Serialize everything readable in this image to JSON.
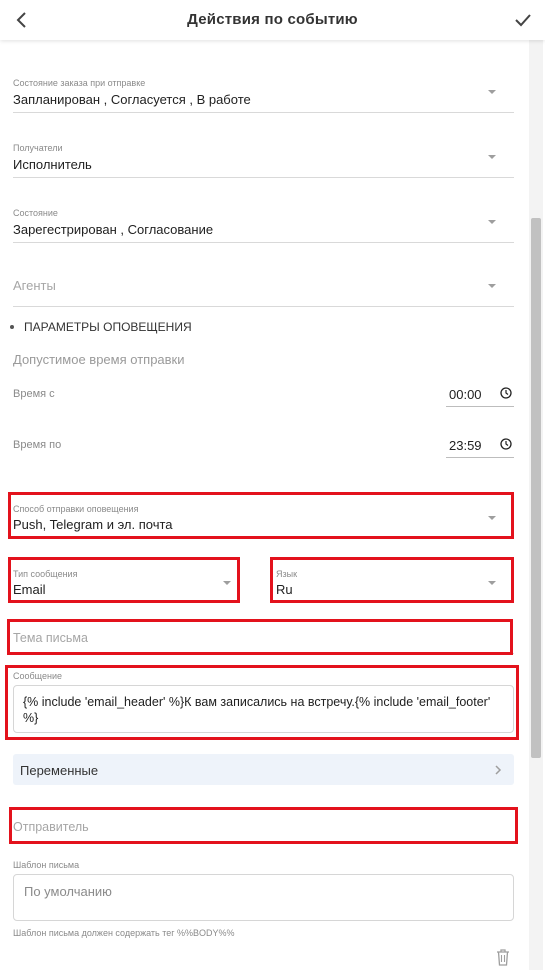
{
  "header": {
    "title": "Действия по событию"
  },
  "fields": {
    "order_state": {
      "label": "Состояние заказа при отправке",
      "value": "Запланирован , Согласуется , В работе"
    },
    "recipients": {
      "label": "Получатели",
      "value": "Исполнитель"
    },
    "state": {
      "label": "Состояние",
      "value": "Зарегестрирован , Согласование"
    },
    "agents": {
      "placeholder": "Агенты"
    }
  },
  "notification": {
    "section_title": "ПАРАМЕТРЫ ОПОВЕЩЕНИЯ",
    "allowed_time_title": "Допустимое время отправки",
    "time_from": {
      "label": "Время с",
      "value": "00:00"
    },
    "time_to": {
      "label": "Время по",
      "value": "23:59"
    },
    "method": {
      "label": "Способ отправки оповещения",
      "value": "Push, Telegram и эл. почта"
    },
    "message_type": {
      "label": "Тип сообщения",
      "value": "Email"
    },
    "language": {
      "label": "Язык",
      "value": "Ru"
    },
    "subject": {
      "placeholder": "Тема письма"
    },
    "message": {
      "label": "Сообщение",
      "value": "{% include 'email_header' %}К вам записались на встречу.{% include 'email_footer' %}"
    },
    "variables_label": "Переменные",
    "sender": {
      "placeholder": "Отправитель"
    },
    "template": {
      "label": "Шаблон письма",
      "placeholder": "По умолчанию",
      "hint": "Шаблон письма должен содержать тег %%BODY%%"
    }
  },
  "colors": {
    "highlight": "#e3121c",
    "variables_bg": "#eef3fa"
  },
  "icons": [
    "back-arrow-icon",
    "check-icon",
    "chevron-down-icon",
    "clock-icon",
    "chevron-right-icon",
    "trash-icon"
  ]
}
